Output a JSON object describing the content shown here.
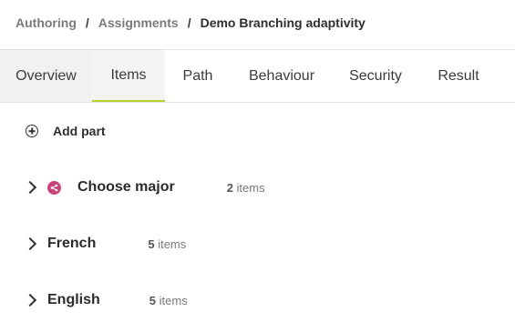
{
  "breadcrumb": {
    "items": [
      "Authoring",
      "Assignments"
    ],
    "separator": "/",
    "current": "Demo Branching adaptivity"
  },
  "tabs": [
    "Overview",
    "Items",
    "Path",
    "Behaviour",
    "Security",
    "Result"
  ],
  "active_tab": "Items",
  "add_part": {
    "label": "Add part",
    "icon": "plus-circle-icon"
  },
  "parts": [
    {
      "title": "Choose major",
      "count": "2",
      "count_suffix": "items",
      "icon": "branch-icon",
      "icon_color": "#c8437a"
    },
    {
      "title": "French",
      "count": "5",
      "count_suffix": "items"
    },
    {
      "title": "English",
      "count": "5",
      "count_suffix": "items"
    }
  ],
  "colors": {
    "accent": "#b8d12a",
    "branch": "#c8437a"
  }
}
